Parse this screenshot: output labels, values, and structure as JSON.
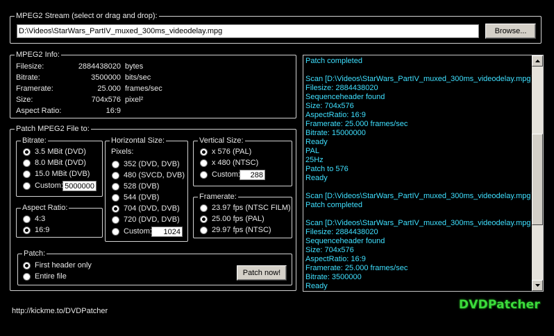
{
  "stream": {
    "legend": "MPEG2 Stream (select or drag and drop):",
    "path": "D:\\Videos\\StarWars_PartIV_muxed_300ms_videodelay.mpg",
    "browse_label": "Browse..."
  },
  "info": {
    "legend": "MPEG2 Info:",
    "rows": [
      {
        "label": "Filesize:",
        "value": "2884438020",
        "unit": "bytes"
      },
      {
        "label": "Bitrate:",
        "value": "3500000",
        "unit": "bits/sec"
      },
      {
        "label": "Framerate:",
        "value": "25.000",
        "unit": "frames/sec"
      },
      {
        "label": "Size:",
        "value": "704x576",
        "unit": "pixel²"
      },
      {
        "label": "Aspect Ratio:",
        "value": "16:9",
        "unit": ""
      }
    ]
  },
  "patch": {
    "legend": "Patch MPEG2 File to:",
    "bitrate": {
      "legend": "Bitrate:",
      "options": [
        "3.5 MBit (DVD)",
        "8.0 MBit (DVD)",
        "15.0 MBit (DVB)",
        "Custom:"
      ],
      "selected": 0,
      "custom_value": "5000000"
    },
    "aspect": {
      "legend": "Aspect Ratio:",
      "options": [
        "4:3",
        "16:9"
      ],
      "selected": 1
    },
    "horizontal": {
      "legend": "Horizontal Size:",
      "sublabel": "Pixels:",
      "options": [
        "352 (DVD, DVB)",
        "480 (SVCD, DVB)",
        "528 (DVB)",
        "544 (DVB)",
        "704 (DVD, DVB)",
        "720 (DVD, DVB)",
        "Custom:"
      ],
      "selected": 4,
      "custom_value": "1024"
    },
    "vertical": {
      "legend": "Vertical Size:",
      "options": [
        "x 576 (PAL)",
        "x 480 (NTSC)",
        "Custom:"
      ],
      "selected": 0,
      "custom_value": "288"
    },
    "framerate": {
      "legend": "Framerate:",
      "options": [
        "23.97 fps (NTSC FILM)",
        "25.00 fps (PAL)",
        "29.97 fps (NTSC)"
      ],
      "selected": 1
    },
    "mode": {
      "legend": "Patch:",
      "options": [
        "First header only",
        "Entire file"
      ],
      "selected": 0
    },
    "patch_now_label": "Patch now!"
  },
  "log": {
    "lines": [
      "Patch completed",
      "",
      "Scan [D:\\Videos\\StarWars_PartIV_muxed_300ms_videodelay.mpg]...",
      "Filesize: 2884438020",
      "Sequenceheader found",
      "Size: 704x576",
      "AspectRatio: 16:9",
      "Framerate: 25.000 frames/sec",
      "Bitrate: 15000000",
      "Ready",
      "PAL",
      "25Hz",
      "Patch to 576",
      "Ready",
      "",
      "Scan [D:\\Videos\\StarWars_PartIV_muxed_300ms_videodelay.mpg]...",
      "Patch completed",
      "",
      "Scan [D:\\Videos\\StarWars_PartIV_muxed_300ms_videodelay.mpg]...",
      "Filesize: 2884438020",
      "Sequenceheader found",
      "Size: 704x576",
      "AspectRatio: 16:9",
      "Framerate: 25.000 frames/sec",
      "Bitrate: 3500000",
      "Ready"
    ],
    "scroll_position": 0.55
  },
  "footer": {
    "url": "http://kickme.to/DVDPatcher",
    "brand": "DVDPatcher"
  },
  "colors": {
    "log_text": "#3fe0ff",
    "brand": "#3cdc3c",
    "background": "#000000"
  }
}
